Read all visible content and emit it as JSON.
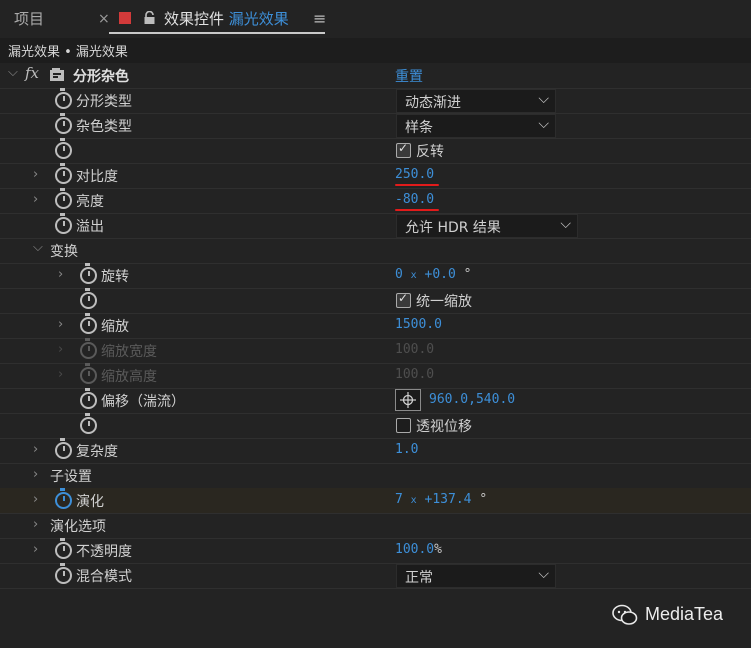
{
  "tabs": {
    "project": "项目",
    "close": "×",
    "effects_prefix": "效果控件",
    "effects_layer": "漏光效果",
    "menu": "≡"
  },
  "breadcrumb": "漏光效果 • 漏光效果",
  "effect": {
    "fx": "fx",
    "name": "分形杂色",
    "reset": "重置"
  },
  "props": {
    "fractal_type": {
      "label": "分形类型",
      "value": "动态渐进"
    },
    "noise_type": {
      "label": "杂色类型",
      "value": "样条"
    },
    "invert": {
      "label": "反转",
      "checked": true
    },
    "contrast": {
      "label": "对比度",
      "value": "250.0"
    },
    "brightness": {
      "label": "亮度",
      "value": "-80.0"
    },
    "overflow": {
      "label": "溢出",
      "value": "允许 HDR 结果"
    },
    "transform": {
      "label": "变换"
    },
    "rotation": {
      "label": "旋转",
      "turns": "0",
      "x": "x",
      "degrees": "+0.0",
      "deg": "°"
    },
    "uniform_scale": {
      "label": "统一缩放",
      "checked": true
    },
    "scale": {
      "label": "缩放",
      "value": "1500.0"
    },
    "scale_width": {
      "label": "缩放宽度",
      "value": "100.0"
    },
    "scale_height": {
      "label": "缩放高度",
      "value": "100.0"
    },
    "offset": {
      "label": "偏移（湍流）",
      "value": "960.0,540.0"
    },
    "perspective": {
      "label": "透视位移",
      "checked": false
    },
    "complexity": {
      "label": "复杂度",
      "value": "1.0"
    },
    "sub_settings": {
      "label": "子设置"
    },
    "evolution": {
      "label": "演化",
      "turns": "7",
      "x": "x",
      "degrees": "+137.4",
      "deg": "°"
    },
    "evolution_options": {
      "label": "演化选项"
    },
    "opacity": {
      "label": "不透明度",
      "value": "100.0",
      "unit": "%"
    },
    "blend_mode": {
      "label": "混合模式",
      "value": "正常"
    }
  },
  "watermark": "MediaTea",
  "colors": {
    "accent": "#3d8fd8",
    "highlight": "#e21b1b",
    "background": "#232323"
  }
}
